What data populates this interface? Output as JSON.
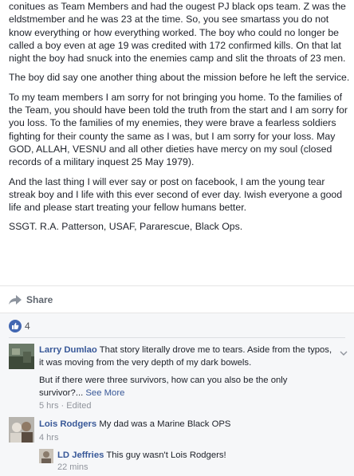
{
  "post": {
    "paragraphs": [
      "conitues as Team Members and had the ougest PJ black ops team. Z was the eldstmember and he was 23 at the time. So, you see smartass you do not know everything or how everything worked. The boy who could no longer be called a boy even at age 19 was credited with 172 confirmed kills. On that lat night the boy had snuck into the enemies camp and slit the throats of 23 men.",
      "The boy did say one another thing about the mission before he left the service.",
      "To my team members I am sorry for not bringing you home. To the families of the Team, you should have been told the truth from the start and I am sorry for you loss. To the families of my enemies, they were brave a fearless soldiers fighting for their county the same as I was, but I am sorry for your loss. May GOD, ALLAH, VESNU and all other dieties have mercy on my soul (closed records of a military inquest 25 May 1979).",
      "And the last thing I will ever say or post on facebook, I am the young tear streak boy and I life with this ever second of ever day. Iwish everyone a good life and please start treating your fellow humans better.",
      "SSGT. R.A. Patterson, USAF, Pararescue, Black Ops."
    ]
  },
  "actions": {
    "share_label": "Share"
  },
  "reactions": {
    "count": "4"
  },
  "comments": [
    {
      "author": "Larry Dumlao",
      "text": "That story literally drove me to tears. Aside from the typos, it was moving from the very depth of my dark bowels.",
      "text2": "But if there were three survivors, how can you also be the only survivor?...",
      "see_more": "See More",
      "time": "5 hrs",
      "edited": "Edited"
    },
    {
      "author": "Lois Rodgers",
      "text": "My dad was a Marine Black OPS",
      "time": "4 hrs"
    },
    {
      "author": "LD Jeffries",
      "text": "This guy wasn't Lois Rodgers!",
      "time": "22 mins"
    }
  ],
  "colors": {
    "link": "#385898",
    "like_badge": "#4267b2",
    "comments_bg": "#f6f7f9"
  }
}
